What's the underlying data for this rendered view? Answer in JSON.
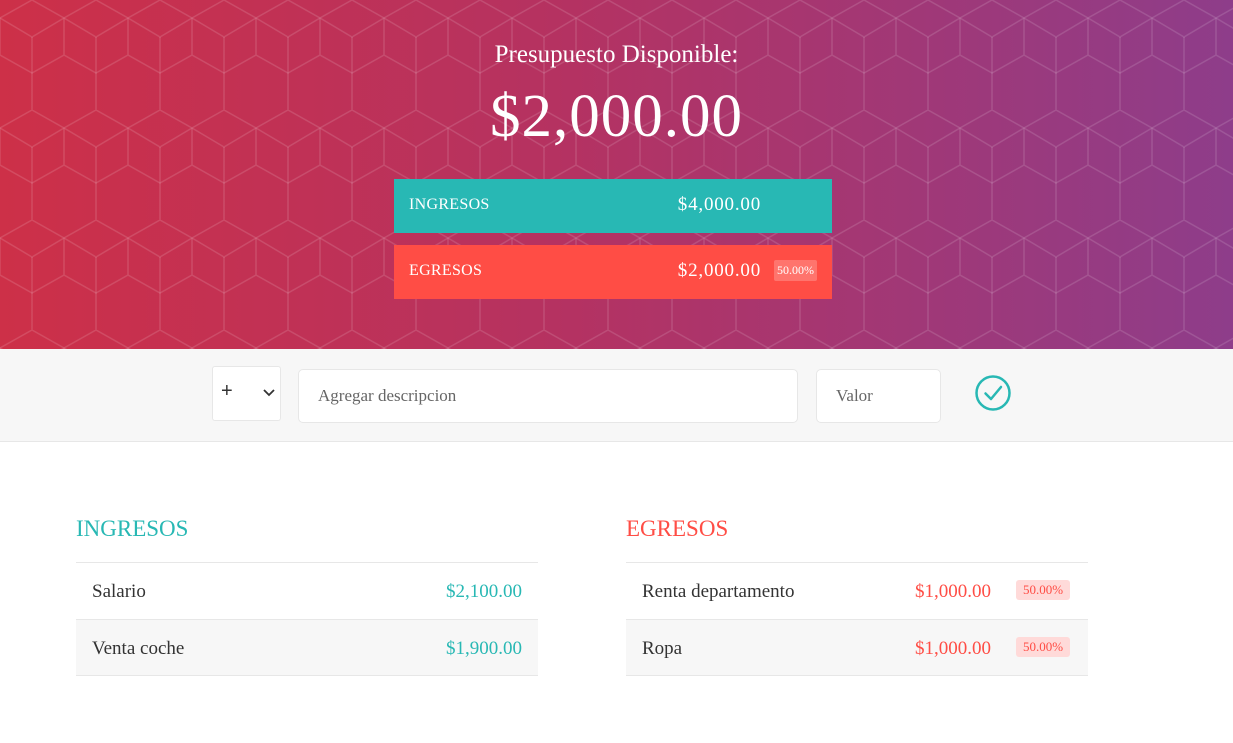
{
  "header": {
    "title": "Presupuesto Disponible:",
    "available": "$2,000.00",
    "income": {
      "label": "INGRESOS",
      "value": "$4,000.00"
    },
    "expenses": {
      "label": "EGRESOS",
      "value": "$2,000.00",
      "percentage": "50.00%"
    }
  },
  "add_form": {
    "type_selected": "+",
    "description_placeholder": "Agregar descripcion",
    "value_placeholder": "Valor",
    "submit_icon": "check-circle-icon"
  },
  "income_list": {
    "title": "INGRESOS",
    "items": [
      {
        "description": "Salario",
        "value": "$2,100.00"
      },
      {
        "description": "Venta coche",
        "value": "$1,900.00"
      }
    ]
  },
  "expense_list": {
    "title": "EGRESOS",
    "items": [
      {
        "description": "Renta departamento",
        "value": "$1,000.00",
        "percentage": "50.00%"
      },
      {
        "description": "Ropa",
        "value": "$1,000.00",
        "percentage": "50.00%"
      }
    ]
  },
  "colors": {
    "income": "#28b8b4",
    "expense": "#ff4d45",
    "gradient_start": "#cd3048",
    "gradient_end": "#8e3d8a"
  }
}
